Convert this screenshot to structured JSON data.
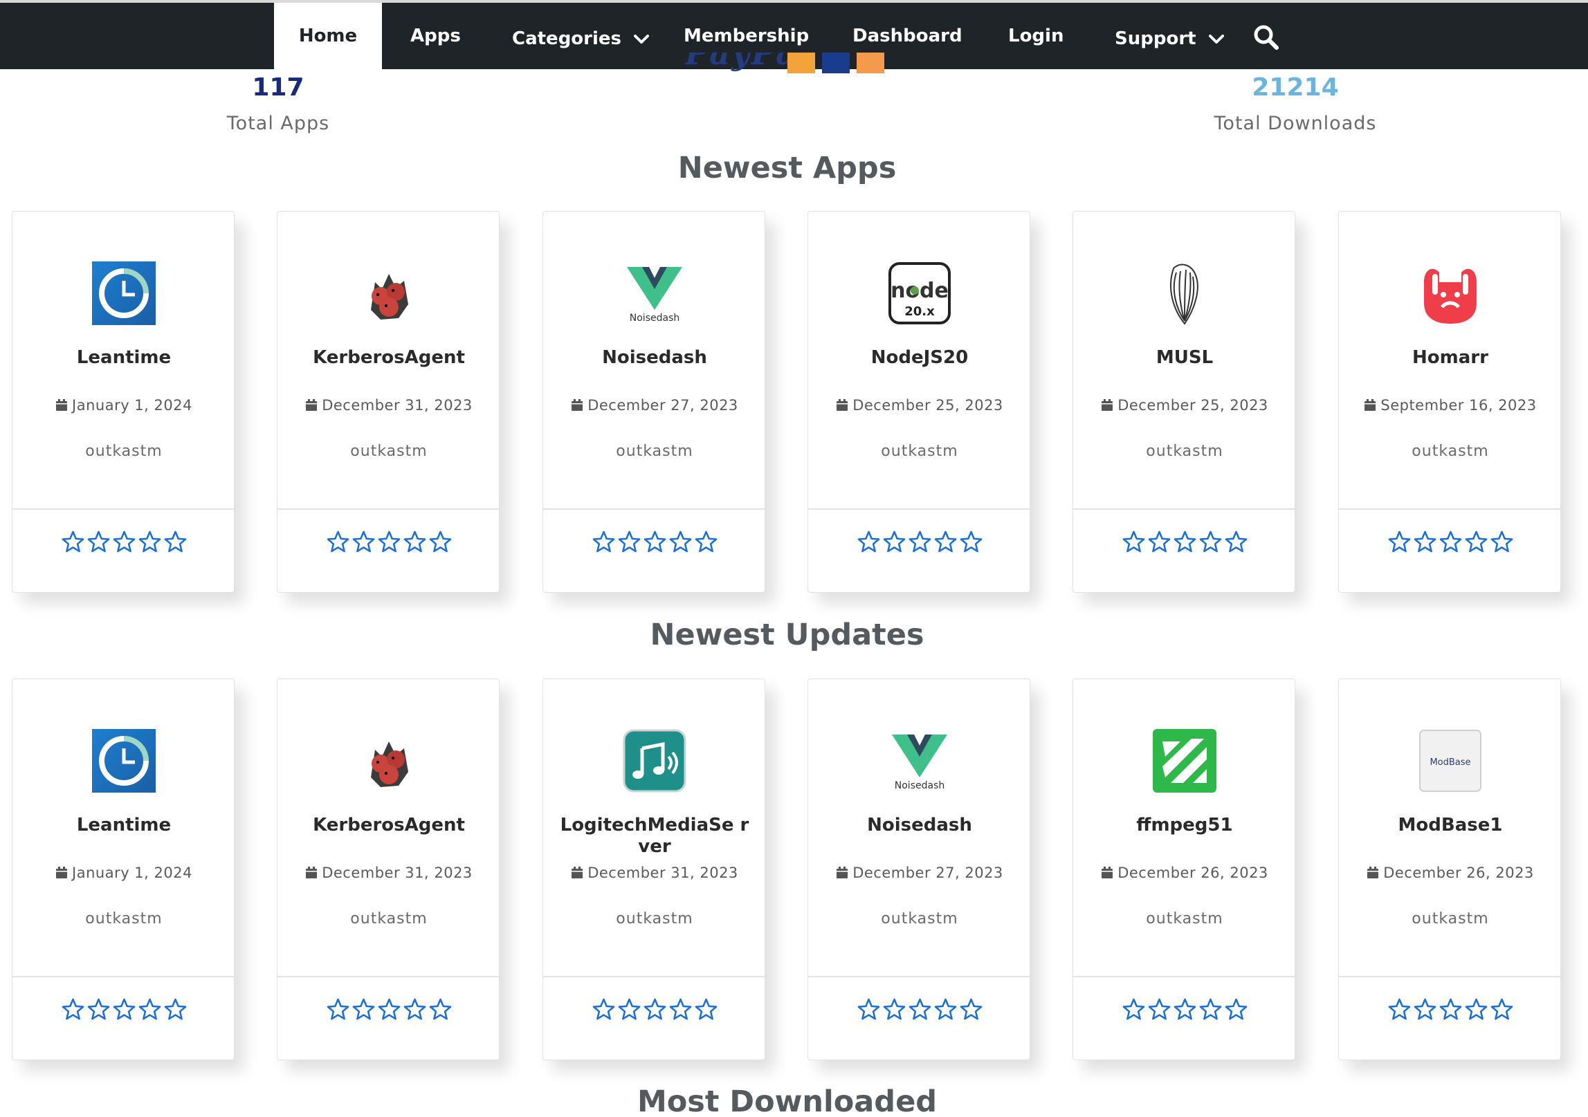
{
  "nav": {
    "items": [
      {
        "label": "Home"
      },
      {
        "label": "Apps"
      },
      {
        "label": "Categories"
      },
      {
        "label": "Membership"
      },
      {
        "label": "Dashboard"
      },
      {
        "label": "Login"
      },
      {
        "label": "Support"
      }
    ],
    "search_icon": "search-icon",
    "active": "Home"
  },
  "stats": {
    "total_apps": {
      "value": "117",
      "label": "Total Apps",
      "color": "#1a2a7a"
    },
    "total_downloads": {
      "value": "21214",
      "label": "Total Downloads",
      "color": "#6ab4dd"
    }
  },
  "sections": {
    "newest_apps": {
      "title": "Newest Apps",
      "cards": [
        {
          "name": "Leantime",
          "date": "January 1, 2024",
          "author": "outkastm",
          "icon": "clock-icon",
          "rating": 0
        },
        {
          "name": "KerberosAgent",
          "date": "December 31, 2023",
          "author": "outkastm",
          "icon": "cerberus-icon",
          "rating": 0
        },
        {
          "name": "Noisedash",
          "date": "December 27, 2023",
          "author": "outkastm",
          "icon": "noisedash-icon",
          "rating": 0,
          "icon_text": "Noisedash"
        },
        {
          "name": "NodeJS20",
          "date": "December 25, 2023",
          "author": "outkastm",
          "icon": "node-icon",
          "rating": 0,
          "icon_text": "node",
          "icon_subtext": "20.x"
        },
        {
          "name": "MUSL",
          "date": "December 25, 2023",
          "author": "outkastm",
          "icon": "shell-icon",
          "rating": 0
        },
        {
          "name": "Homarr",
          "date": "September 16, 2023",
          "author": "outkastm",
          "icon": "homarr-icon",
          "rating": 0
        }
      ]
    },
    "newest_updates": {
      "title": "Newest Updates",
      "cards": [
        {
          "name": "Leantime",
          "date": "January 1, 2024",
          "author": "outkastm",
          "icon": "clock-icon",
          "rating": 0
        },
        {
          "name": "KerberosAgent",
          "date": "December 31, 2023",
          "author": "outkastm",
          "icon": "cerberus-icon",
          "rating": 0
        },
        {
          "name": "LogitechMediaServer",
          "name_display": "LogitechMediaSe rver",
          "date": "December 31, 2023",
          "author": "outkastm",
          "icon": "music-icon",
          "rating": 0
        },
        {
          "name": "Noisedash",
          "date": "December 27, 2023",
          "author": "outkastm",
          "icon": "noisedash-icon",
          "rating": 0,
          "icon_text": "Noisedash"
        },
        {
          "name": "ffmpeg51",
          "date": "December 26, 2023",
          "author": "outkastm",
          "icon": "ffmpeg-icon",
          "rating": 0
        },
        {
          "name": "ModBase1",
          "date": "December 26, 2023",
          "author": "outkastm",
          "icon": "modbase-icon",
          "rating": 0,
          "icon_text": "ModBase"
        }
      ]
    },
    "most_downloaded": {
      "title": "Most Downloaded"
    }
  },
  "colors": {
    "nav_bg": "#1f2428",
    "star": "#1a6fd1",
    "section_title": "#555a5e"
  }
}
